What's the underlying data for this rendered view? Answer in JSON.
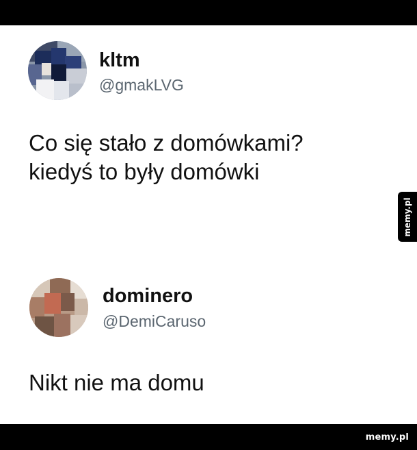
{
  "tweets": [
    {
      "display_name": "kltm",
      "handle": "@gmakLVG",
      "lines": [
        "Co się stało z domówkami?",
        "kiedyś to były domówki"
      ],
      "avatar_icon": "pixelated-avatar-icon"
    },
    {
      "display_name": "dominero",
      "handle": "@DemiCaruso",
      "lines": [
        "Nikt nie ma domu"
      ],
      "avatar_icon": "pixelated-avatar-icon"
    }
  ],
  "watermark": {
    "side_tab": "memy.pl",
    "footer": "memy.pl"
  },
  "colors": {
    "bars": "#000000",
    "text": "#111111",
    "handle": "#5b6670"
  }
}
